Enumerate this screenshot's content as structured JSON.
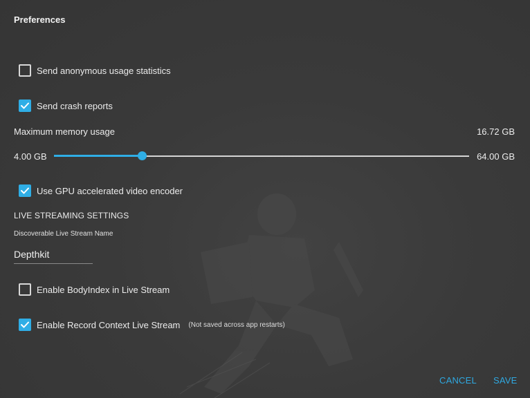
{
  "dialog": {
    "title": "Preferences"
  },
  "options": {
    "anonymous_stats": {
      "label": "Send anonymous usage statistics",
      "checked": false
    },
    "crash_reports": {
      "label": "Send crash reports",
      "checked": true
    },
    "gpu_encoder": {
      "label": "Use GPU accelerated video encoder",
      "checked": true
    },
    "body_index": {
      "label": "Enable BodyIndex in Live Stream",
      "checked": false
    },
    "record_context": {
      "label": "Enable Record Context Live Stream",
      "checked": true,
      "note": "(Not saved across app restarts)"
    }
  },
  "memory": {
    "label": "Maximum memory usage",
    "value_text": "16.72 GB",
    "min_text": "4.00 GB",
    "max_text": "64.00 GB",
    "min": 4.0,
    "max": 64.0,
    "value": 16.72
  },
  "live_streaming": {
    "heading": "LIVE STREAMING SETTINGS",
    "name_label": "Discoverable Live Stream Name",
    "name_value": "Depthkit"
  },
  "buttons": {
    "cancel": "CANCEL",
    "save": "SAVE"
  },
  "colors": {
    "accent": "#2faee6",
    "background": "#383838",
    "text": "#ececec"
  }
}
